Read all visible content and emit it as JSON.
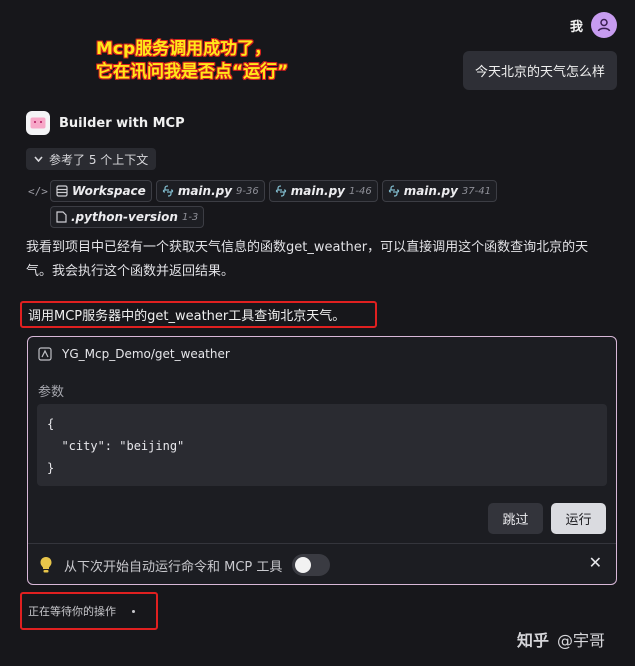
{
  "user": {
    "name": "我",
    "message": "今天北京的天气怎么样"
  },
  "annotation": {
    "line1": "Mcp服务调用成功了，",
    "line2": "它在讯问我是否点“运行”"
  },
  "assistant": {
    "name": "Builder with MCP"
  },
  "context": {
    "button_label": "参考了 5 个上下文",
    "refs": [
      {
        "name": "Workspace",
        "range": ""
      },
      {
        "name": "main.py",
        "range": "9-36"
      },
      {
        "name": "main.py",
        "range": "1-46"
      },
      {
        "name": "main.py",
        "range": "37-41"
      },
      {
        "name": ".python-version",
        "range": "1-3"
      }
    ]
  },
  "body_text": "我看到项目中已经有一个获取天气信息的函数get_weather，可以直接调用这个函数查询北京的天气。我会执行这个函数并返回结果。",
  "call_text": "调用MCP服务器中的get_weather工具查询北京天气。",
  "tool_card": {
    "title": "YG_Mcp_Demo/get_weather",
    "params_label": "参数",
    "params_json": "{\n  \"city\": \"beijing\"\n}",
    "skip_label": "跳过",
    "run_label": "运行",
    "auto_run_text": "从下次开始自动运行命令和 MCP 工具",
    "auto_run_enabled": false
  },
  "status_text": "正在等待你的操作",
  "watermark": {
    "brand": "知乎",
    "author": "@宇哥"
  },
  "colors": {
    "background": "#17171b",
    "highlight_border": "#e02020",
    "annotation_text": "#ffe81a",
    "card_border": "#d8b8d8"
  }
}
